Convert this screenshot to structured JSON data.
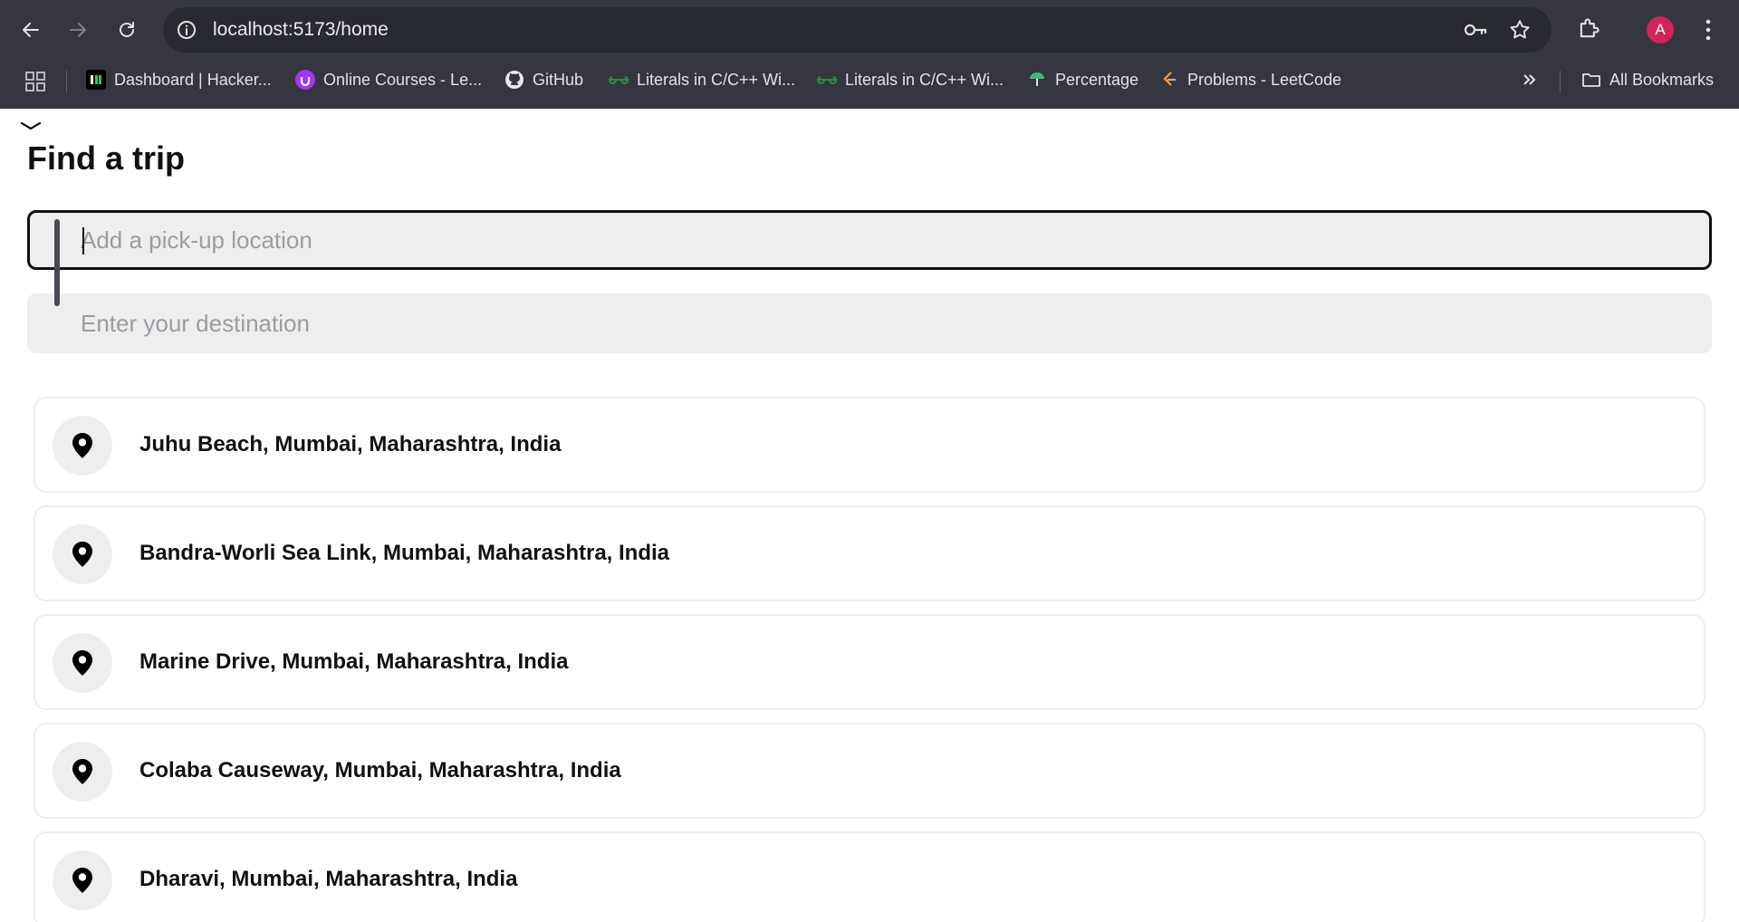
{
  "browser": {
    "url": "localhost:5173/home",
    "avatar_letter": "A",
    "bookmarks": [
      {
        "label": "Dashboard | Hacker...",
        "icon": "hackerrank-icon"
      },
      {
        "label": "Online Courses - Le...",
        "icon": "udemy-icon"
      },
      {
        "label": "GitHub",
        "icon": "github-icon"
      },
      {
        "label": "Literals in C/C++ Wi...",
        "icon": "geeksforgeeks-icon"
      },
      {
        "label": "Literals in C/C++ Wi...",
        "icon": "geeksforgeeks-icon"
      },
      {
        "label": "Percentage",
        "icon": "percentage-icon"
      },
      {
        "label": "Problems - LeetCode",
        "icon": "leetcode-icon"
      }
    ],
    "all_bookmarks_label": "All Bookmarks"
  },
  "page": {
    "title": "Find a trip",
    "pickup": {
      "placeholder": "Add a pick-up location",
      "value": ""
    },
    "destination": {
      "placeholder": "Enter your destination",
      "value": ""
    },
    "suggestions": [
      "Juhu Beach, Mumbai, Maharashtra, India",
      "Bandra-Worli Sea Link, Mumbai, Maharashtra, India",
      "Marine Drive, Mumbai, Maharashtra, India",
      "Colaba Causeway, Mumbai, Maharashtra, India",
      "Dharavi, Mumbai, Maharashtra, India"
    ]
  }
}
